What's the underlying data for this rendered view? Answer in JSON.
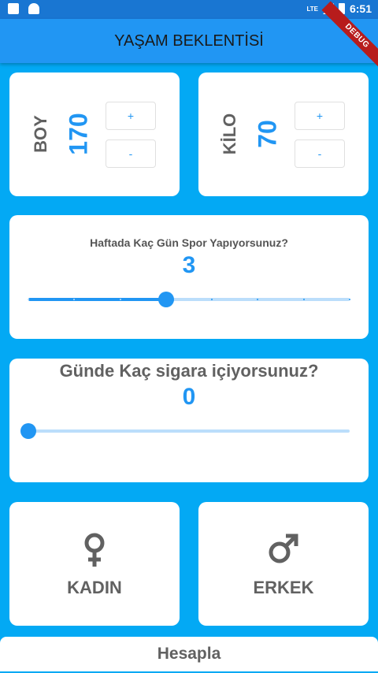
{
  "status_bar": {
    "network": "LTE",
    "time": "6:51"
  },
  "app_bar": {
    "title": "YAŞAM BEKLENTİSİ",
    "debug_banner": "DEBUG"
  },
  "boy": {
    "label": "BOY",
    "value": "170",
    "plus": "+",
    "minus": "-"
  },
  "kilo": {
    "label": "KİLO",
    "value": "70",
    "plus": "+",
    "minus": "-"
  },
  "spor": {
    "question": "Haftada Kaç Gün Spor Yapıyorsunuz?",
    "value": "3",
    "min": 0,
    "max": 7,
    "current": 3
  },
  "sigara": {
    "question": "Günde Kaç sigara içiyorsunuz?",
    "value": "0",
    "current": 0
  },
  "gender": {
    "kadin": {
      "label": "KADIN",
      "icon": "female-symbol-icon"
    },
    "erkek": {
      "label": "ERKEK",
      "icon": "male-symbol-icon"
    }
  },
  "calculate": {
    "label": "Hesapla"
  },
  "colors": {
    "primary": "#2196F3",
    "background": "#03A9F4",
    "track_inactive": "#BBDEFB",
    "label_gray": "#616161"
  }
}
